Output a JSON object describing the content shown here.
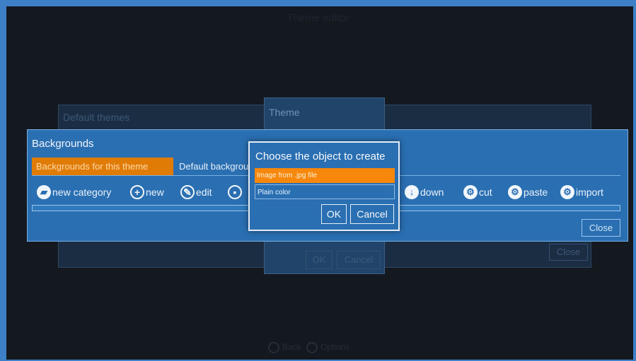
{
  "app": {
    "title": "Theme editor"
  },
  "dim_themes": {
    "label": "Default themes",
    "close_label": "Close"
  },
  "dim_theme": {
    "label": "Theme",
    "ok_label": "OK",
    "cancel_label": "Cancel"
  },
  "bottom_bar": {
    "left": "Back",
    "right": "Options"
  },
  "backgrounds": {
    "title": "Backgrounds",
    "tabs": [
      {
        "label": "Backgrounds for this theme",
        "active": true
      },
      {
        "label": "Default backgrounds",
        "active": false
      }
    ],
    "toolbar": {
      "new_category": "new category",
      "new": "new",
      "edit": "edit",
      "down": "down",
      "cut": "cut",
      "paste": "paste",
      "import": "import"
    },
    "close_label": "Close"
  },
  "chooser": {
    "title": "Choose the object to create",
    "options": [
      {
        "label": "Image from .jpg file",
        "selected": true
      },
      {
        "label": "Plain color",
        "selected": false
      }
    ],
    "ok_label": "OK",
    "cancel_label": "Cancel"
  },
  "colors": {
    "accent": "#2a6fb2",
    "selected": "#f7880b",
    "tab_active": "#e07b06",
    "background": "#14181f"
  }
}
